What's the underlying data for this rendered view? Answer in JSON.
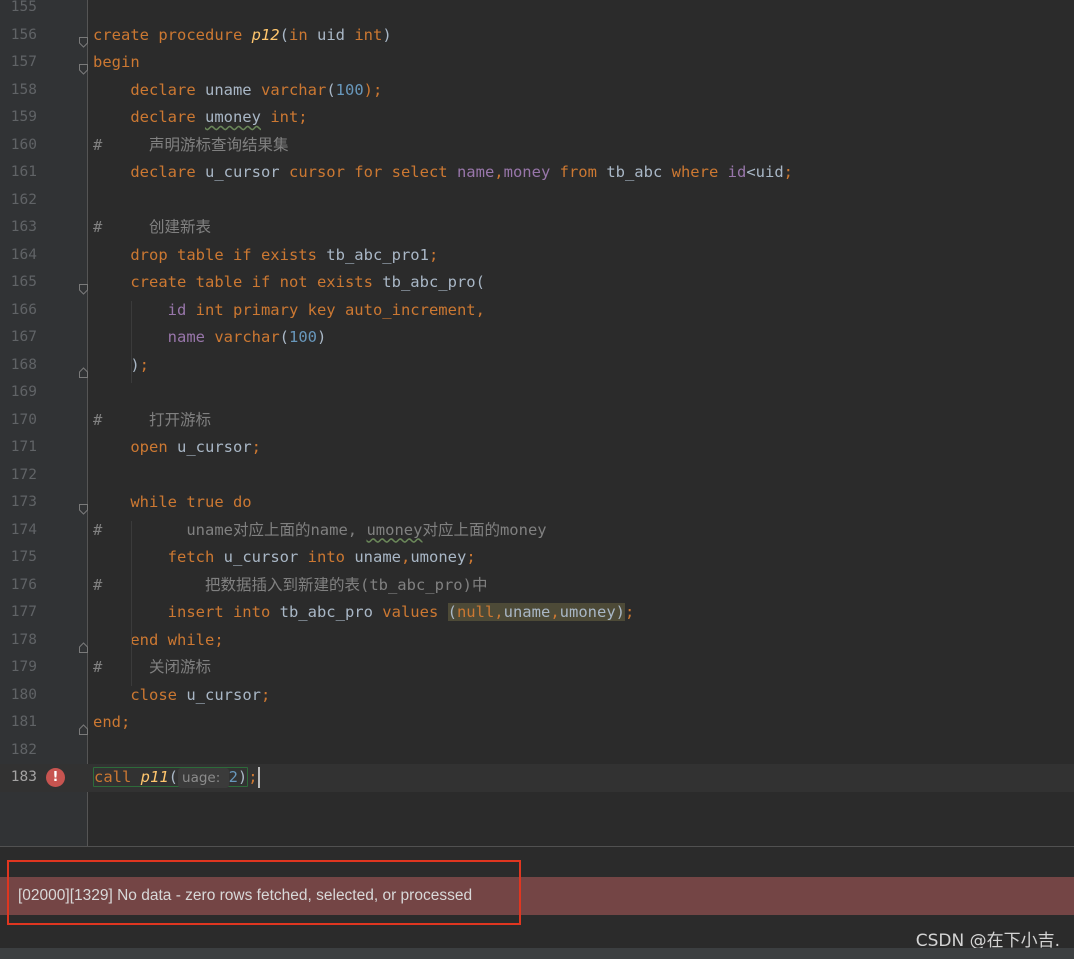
{
  "editor": {
    "lines": [
      {
        "n": "155",
        "tokens": []
      },
      {
        "n": "156",
        "fold": "open",
        "tokens": [
          {
            "t": "create procedure ",
            "c": "kw"
          },
          {
            "t": "p12",
            "c": "fn"
          },
          {
            "t": "(",
            "c": "id"
          },
          {
            "t": "in ",
            "c": "kw"
          },
          {
            "t": "uid ",
            "c": "id"
          },
          {
            "t": "int",
            "c": "kw"
          },
          {
            "t": ")",
            "c": "id"
          }
        ]
      },
      {
        "n": "157",
        "fold": "open",
        "tokens": [
          {
            "t": "begin",
            "c": "kw"
          }
        ]
      },
      {
        "n": "158",
        "tokens": [
          {
            "t": "    declare ",
            "c": "kw"
          },
          {
            "t": "uname ",
            "c": "id"
          },
          {
            "t": "varchar",
            "c": "kw"
          },
          {
            "t": "(",
            "c": "id"
          },
          {
            "t": "100",
            "c": "num"
          },
          {
            "t": ");",
            "c": "kw"
          }
        ]
      },
      {
        "n": "159",
        "tokens": [
          {
            "t": "    declare ",
            "c": "kw"
          },
          {
            "t": "umoney",
            "c": "id uwave"
          },
          {
            "t": " int;",
            "c": "kw"
          }
        ]
      },
      {
        "n": "160",
        "tokens": [
          {
            "t": "#     声明游标查询结果集",
            "c": "cm"
          }
        ]
      },
      {
        "n": "161",
        "tokens": [
          {
            "t": "    declare ",
            "c": "kw"
          },
          {
            "t": "u_cursor ",
            "c": "id"
          },
          {
            "t": "cursor for select ",
            "c": "kw"
          },
          {
            "t": "name",
            "c": "col"
          },
          {
            "t": ",",
            "c": "kw"
          },
          {
            "t": "money ",
            "c": "col"
          },
          {
            "t": "from ",
            "c": "kw"
          },
          {
            "t": "tb_abc ",
            "c": "id"
          },
          {
            "t": "where ",
            "c": "kw"
          },
          {
            "t": "id",
            "c": "col"
          },
          {
            "t": "<",
            "c": "id"
          },
          {
            "t": "uid",
            "c": "id"
          },
          {
            "t": ";",
            "c": "kw"
          }
        ]
      },
      {
        "n": "162",
        "tokens": []
      },
      {
        "n": "163",
        "tokens": [
          {
            "t": "#     创建新表",
            "c": "cm"
          }
        ]
      },
      {
        "n": "164",
        "tokens": [
          {
            "t": "    drop table if exists ",
            "c": "kw"
          },
          {
            "t": "tb_abc_pro1",
            "c": "id"
          },
          {
            "t": ";",
            "c": "kw"
          }
        ]
      },
      {
        "n": "165",
        "fold": "open",
        "tokens": [
          {
            "t": "    create table if not exists ",
            "c": "kw"
          },
          {
            "t": "tb_abc_pro",
            "c": "id"
          },
          {
            "t": "(",
            "c": "id"
          }
        ]
      },
      {
        "n": "166",
        "tokens": [
          {
            "t": "        ",
            "c": "id"
          },
          {
            "t": "id ",
            "c": "col"
          },
          {
            "t": "int primary key auto_increment,",
            "c": "kw"
          }
        ]
      },
      {
        "n": "167",
        "tokens": [
          {
            "t": "        ",
            "c": "id"
          },
          {
            "t": "name ",
            "c": "col"
          },
          {
            "t": "varchar",
            "c": "kw"
          },
          {
            "t": "(",
            "c": "id"
          },
          {
            "t": "100",
            "c": "num"
          },
          {
            "t": ")",
            "c": "id"
          }
        ]
      },
      {
        "n": "168",
        "fold": "close",
        "tokens": [
          {
            "t": "    )",
            "c": "id"
          },
          {
            "t": ";",
            "c": "kw"
          }
        ]
      },
      {
        "n": "169",
        "tokens": []
      },
      {
        "n": "170",
        "tokens": [
          {
            "t": "#     打开游标",
            "c": "cm"
          }
        ]
      },
      {
        "n": "171",
        "tokens": [
          {
            "t": "    open ",
            "c": "kw"
          },
          {
            "t": "u_cursor",
            "c": "id"
          },
          {
            "t": ";",
            "c": "kw"
          }
        ]
      },
      {
        "n": "172",
        "tokens": []
      },
      {
        "n": "173",
        "fold": "open",
        "tokens": [
          {
            "t": "    while true do",
            "c": "kw"
          }
        ]
      },
      {
        "n": "174",
        "tokens": [
          {
            "t": "#         uname对应上面的name, ",
            "c": "cm"
          },
          {
            "t": "umoney",
            "c": "cm uwave"
          },
          {
            "t": "对应上面的money",
            "c": "cm"
          }
        ]
      },
      {
        "n": "175",
        "tokens": [
          {
            "t": "        fetch ",
            "c": "kw"
          },
          {
            "t": "u_cursor ",
            "c": "id"
          },
          {
            "t": "into ",
            "c": "kw"
          },
          {
            "t": "uname",
            "c": "id"
          },
          {
            "t": ",",
            "c": "kw"
          },
          {
            "t": "umoney",
            "c": "id"
          },
          {
            "t": ";",
            "c": "kw"
          }
        ]
      },
      {
        "n": "176",
        "tokens": [
          {
            "t": "#           把数据插入到新建的表(tb_abc_pro)中",
            "c": "cm"
          }
        ]
      },
      {
        "n": "177",
        "tokens": [
          {
            "t": "        insert into ",
            "c": "kw"
          },
          {
            "t": "tb_abc_pro ",
            "c": "id"
          },
          {
            "t": "values ",
            "c": "kw"
          },
          {
            "t": "(",
            "c": "id hl-args"
          },
          {
            "t": "null",
            "c": "kw hl-args"
          },
          {
            "t": ",",
            "c": "kw hl-args"
          },
          {
            "t": "uname",
            "c": "id hl-args"
          },
          {
            "t": ",",
            "c": "kw hl-args"
          },
          {
            "t": "umoney",
            "c": "id hl-args"
          },
          {
            "t": ")",
            "c": "id hl-args"
          },
          {
            "t": ";",
            "c": "kw"
          }
        ]
      },
      {
        "n": "178",
        "fold": "close",
        "tokens": [
          {
            "t": "    end while;",
            "c": "kw"
          }
        ]
      },
      {
        "n": "179",
        "tokens": [
          {
            "t": "#     关闭游标",
            "c": "cm"
          }
        ]
      },
      {
        "n": "180",
        "tokens": [
          {
            "t": "    close ",
            "c": "kw"
          },
          {
            "t": "u_cursor",
            "c": "id"
          },
          {
            "t": ";",
            "c": "kw"
          }
        ]
      },
      {
        "n": "181",
        "fold": "close",
        "tokens": [
          {
            "t": "end;",
            "c": "kw"
          }
        ]
      },
      {
        "n": "182",
        "tokens": []
      },
      {
        "n": "183",
        "current": true,
        "error": true,
        "tokens": [
          {
            "t": "call ",
            "c": "kw"
          },
          {
            "t": "p11",
            "c": "fn"
          },
          {
            "t": "(",
            "c": "id"
          },
          {
            "hint": "uage: "
          },
          {
            "t": "2",
            "c": "num"
          },
          {
            "t": ")",
            "c": "id"
          },
          {
            "t": ";",
            "c": "kw"
          }
        ]
      }
    ]
  },
  "error_bar": {
    "message": "[02000][1329] No data - zero rows fetched, selected, or processed"
  },
  "watermark": "CSDN @在下小吉."
}
